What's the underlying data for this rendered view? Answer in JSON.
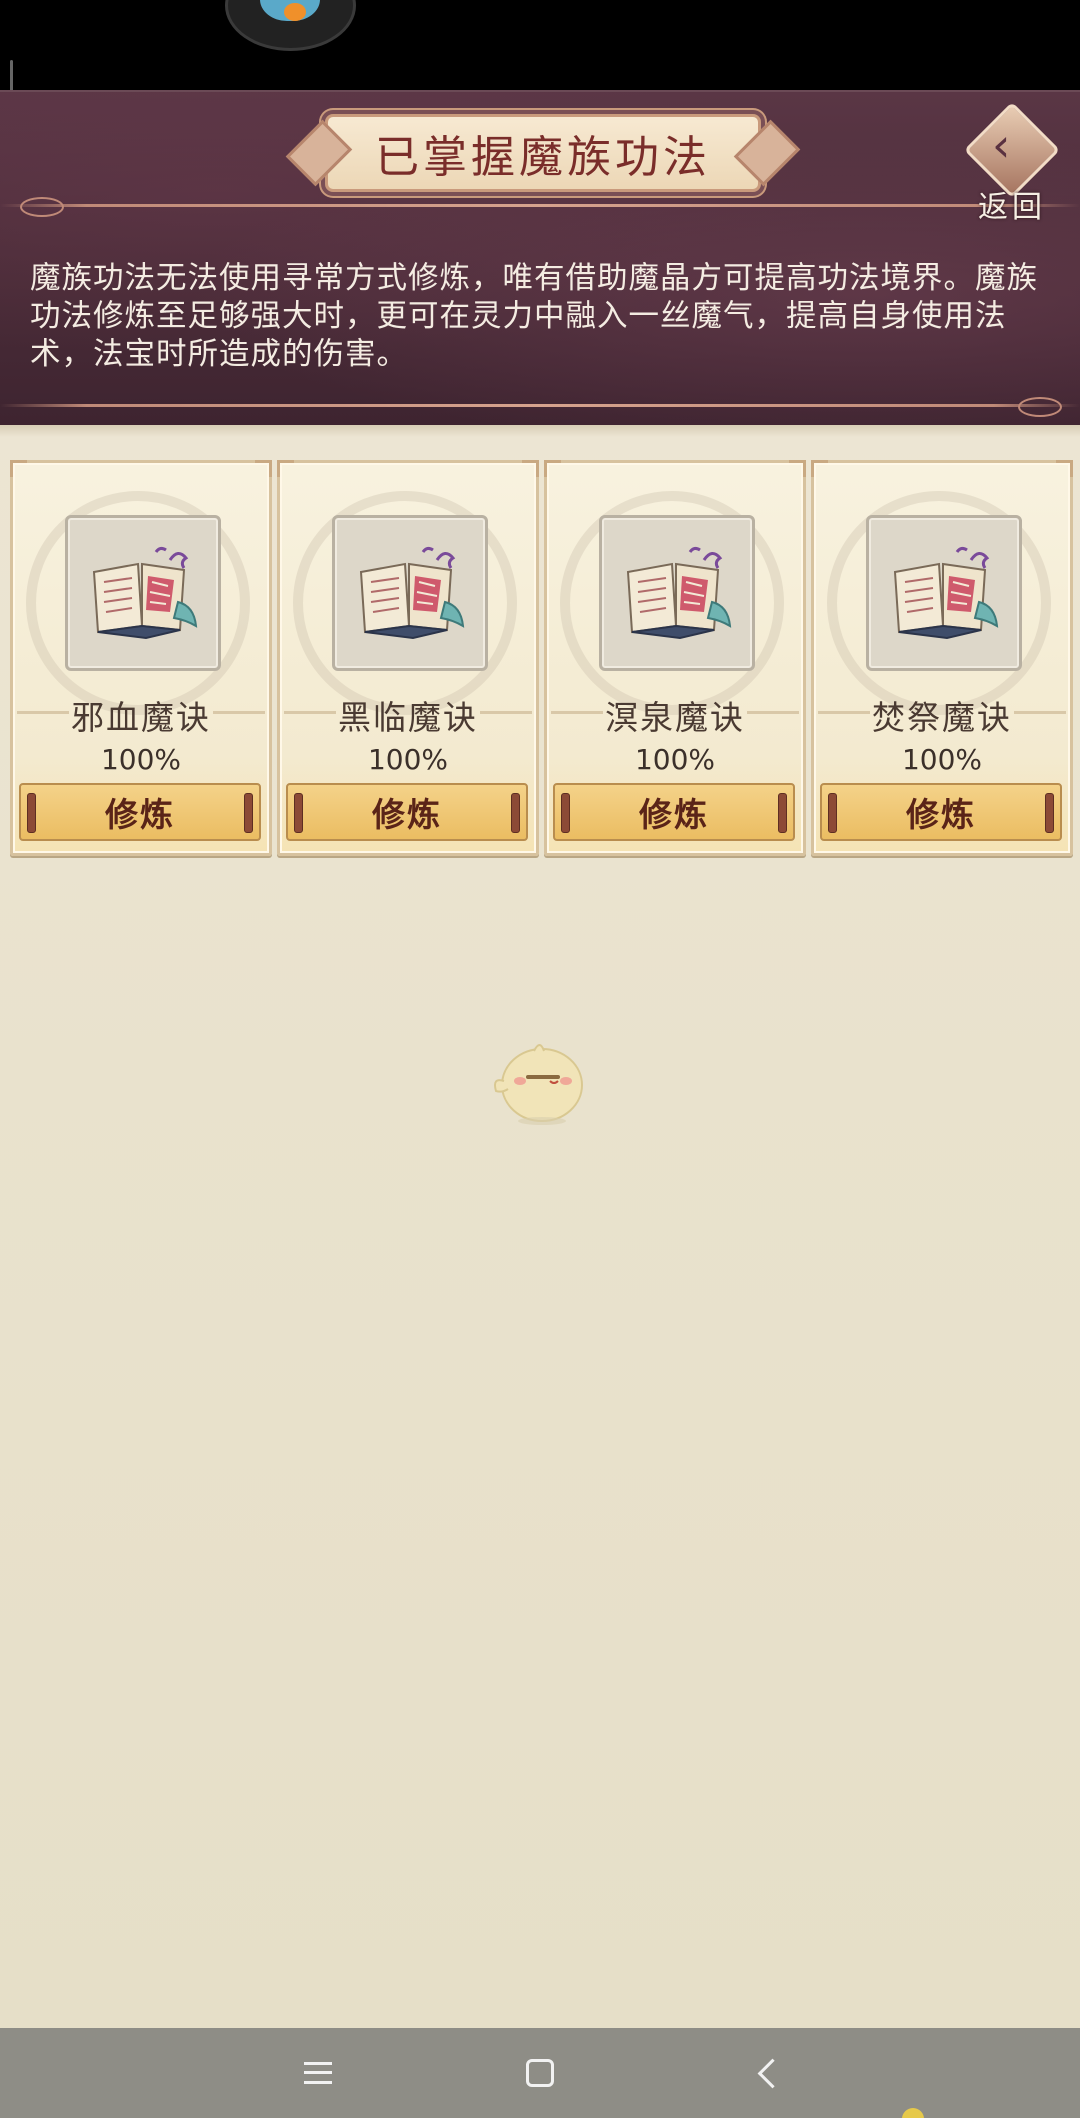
{
  "header": {
    "title": "已掌握魔族功法",
    "back_label": "返回",
    "description": "魔族功法无法使用寻常方式修炼，唯有借助魔晶方可提高功法境界。魔族功法修炼至足够强大时，更可在灵力中融入一丝魔气，提高自身使用法术，法宝时所造成的伤害。"
  },
  "cards": [
    {
      "name": "邪血魔诀",
      "progress": "100%",
      "button": "修炼",
      "icon": "magic-book-icon"
    },
    {
      "name": "黑临魔诀",
      "progress": "100%",
      "button": "修炼",
      "icon": "magic-book-icon"
    },
    {
      "name": "溟泉魔诀",
      "progress": "100%",
      "button": "修炼",
      "icon": "magic-book-icon"
    },
    {
      "name": "焚祭魔诀",
      "progress": "100%",
      "button": "修炼",
      "icon": "magic-book-icon"
    }
  ],
  "navbar": {
    "icons": [
      "menu-icon",
      "home-icon",
      "back-arrow-icon"
    ]
  },
  "colors": {
    "header_bg": "#4a2c38",
    "title_text": "#7a2d2a",
    "parchment": "#e9e2cd",
    "button_gold": "#ebbd62",
    "navbar": "#8e8d86"
  }
}
